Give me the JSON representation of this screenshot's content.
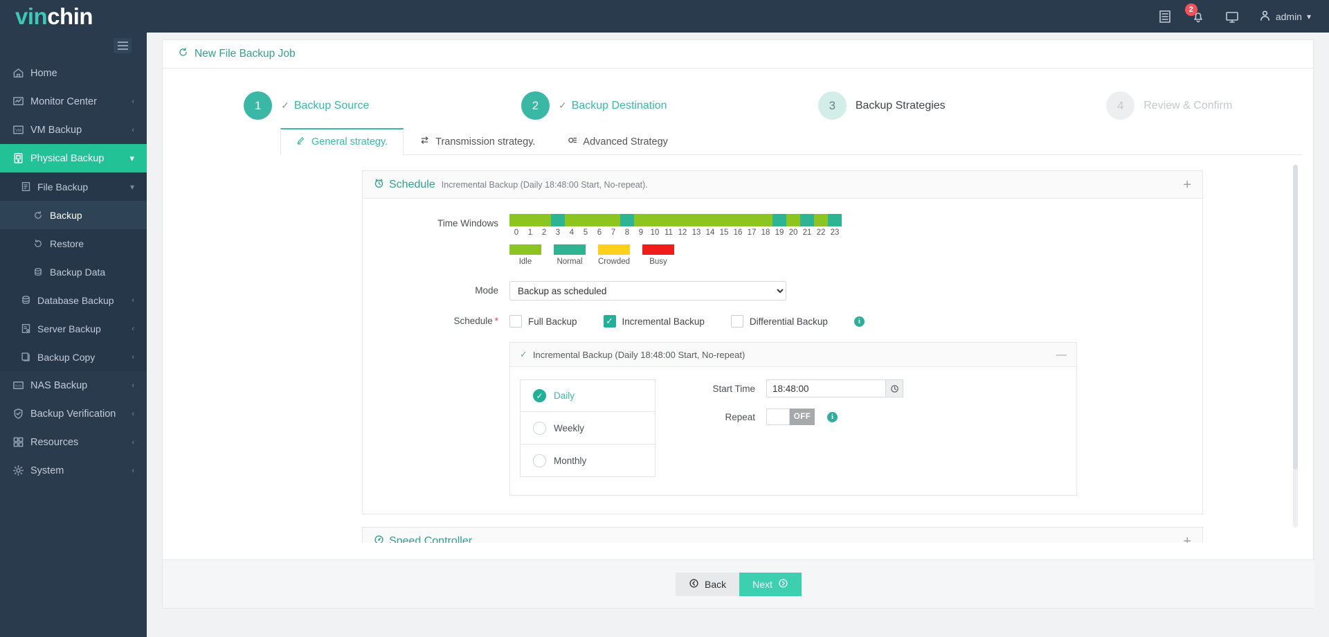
{
  "brand": {
    "part1": "vin",
    "part2": "chin"
  },
  "header": {
    "notifications_badge": "2",
    "user_label": "admin",
    "icons": [
      "log-icon",
      "bell-icon",
      "monitor-icon",
      "user-icon"
    ]
  },
  "sidebar": {
    "items": [
      {
        "label": "Home",
        "icon": "home-icon",
        "chevron": "",
        "level": 0
      },
      {
        "label": "Monitor Center",
        "icon": "monitor-chart-icon",
        "chevron": "‹",
        "level": 0
      },
      {
        "label": "VM Backup",
        "icon": "vm-icon",
        "chevron": "‹",
        "level": 0
      },
      {
        "label": "Physical Backup",
        "icon": "server-icon",
        "chevron": "⌄",
        "level": 0,
        "active": true
      },
      {
        "label": "File Backup",
        "icon": "file-icon",
        "chevron": "⌄",
        "level": 1
      },
      {
        "label": "Backup",
        "icon": "backup-refresh-icon",
        "level": 2,
        "current": true
      },
      {
        "label": "Restore",
        "icon": "restore-icon",
        "level": 2
      },
      {
        "label": "Backup Data",
        "icon": "database-icon",
        "level": 2
      },
      {
        "label": "Database Backup",
        "icon": "database-icon",
        "chevron": "‹",
        "level": 1
      },
      {
        "label": "Server Backup",
        "icon": "server-file-icon",
        "chevron": "‹",
        "level": 1
      },
      {
        "label": "Backup Copy",
        "icon": "copy-icon",
        "chevron": "‹",
        "level": 1
      },
      {
        "label": "NAS Backup",
        "icon": "nas-icon",
        "chevron": "‹",
        "level": 0
      },
      {
        "label": "Backup Verification",
        "icon": "shield-check-icon",
        "chevron": "‹",
        "level": 0
      },
      {
        "label": "Resources",
        "icon": "grid-icon",
        "chevron": "‹",
        "level": 0
      },
      {
        "label": "System",
        "icon": "gear-icon",
        "chevron": "‹",
        "level": 0
      }
    ]
  },
  "page": {
    "title": "New File Backup Job",
    "title_icon": "refresh-icon"
  },
  "steps": [
    {
      "num": "1",
      "label": "Backup Source",
      "state": "done"
    },
    {
      "num": "2",
      "label": "Backup Destination",
      "state": "done"
    },
    {
      "num": "3",
      "label": "Backup Strategies",
      "state": "current"
    },
    {
      "num": "4",
      "label": "Review & Confirm",
      "state": "todo"
    }
  ],
  "tabs": [
    {
      "label": "General strategy.",
      "icon": "pencil-icon",
      "active": true
    },
    {
      "label": "Transmission strategy.",
      "icon": "transfer-icon",
      "active": false
    },
    {
      "label": "Advanced Strategy",
      "icon": "gear-slider-icon",
      "active": false
    }
  ],
  "schedule_panel": {
    "title": "Schedule",
    "icon": "clock-icon",
    "summary": "Incremental Backup (Daily 18:48:00 Start, No-repeat).",
    "toggle": "+",
    "time_windows_label": "Time Windows",
    "mode_label": "Mode",
    "mode_value": "Backup as scheduled",
    "mode_options": [
      "Backup as scheduled"
    ],
    "schedule_label": "Schedule",
    "schedule_required": "*",
    "checkboxes": [
      {
        "label": "Full Backup",
        "checked": false
      },
      {
        "label": "Incremental Backup",
        "checked": true
      },
      {
        "label": "Differential Backup",
        "checked": false
      }
    ],
    "info_icon": "info-icon"
  },
  "chart_data": {
    "type": "heatmap",
    "title": "Time Windows",
    "xlabel": "",
    "ylabel": "",
    "categories": [
      "0",
      "1",
      "2",
      "3",
      "4",
      "5",
      "6",
      "7",
      "8",
      "9",
      "10",
      "11",
      "12",
      "13",
      "14",
      "15",
      "16",
      "17",
      "18",
      "19",
      "20",
      "21",
      "22",
      "23"
    ],
    "values": [
      "Idle",
      "Idle",
      "Idle",
      "Normal",
      "Idle",
      "Idle",
      "Idle",
      "Idle",
      "Normal",
      "Idle",
      "Idle",
      "Idle",
      "Idle",
      "Idle",
      "Idle",
      "Idle",
      "Idle",
      "Idle",
      "Idle",
      "Normal",
      "Idle",
      "Normal",
      "Idle",
      "Normal"
    ],
    "legend": [
      {
        "label": "Idle",
        "color": "#8cc422"
      },
      {
        "label": "Normal",
        "color": "#2eb393"
      },
      {
        "label": "Crowded",
        "color": "#fdd01c"
      },
      {
        "label": "Busy",
        "color": "#f01b1b"
      }
    ],
    "legend_position": "below"
  },
  "incremental_panel": {
    "title": "Incremental Backup (Daily 18:48:00 Start, No-repeat)",
    "check_icon": "check-icon",
    "toggle": "—",
    "frequencies": [
      {
        "label": "Daily",
        "selected": true
      },
      {
        "label": "Weekly",
        "selected": false
      },
      {
        "label": "Monthly",
        "selected": false
      }
    ],
    "start_time_label": "Start Time",
    "start_time_value": "18:48:00",
    "start_time_placeholder": "HH:mm:ss",
    "clock_icon": "clock-icon",
    "repeat_label": "Repeat",
    "repeat_state": "OFF",
    "info_icon": "info-icon"
  },
  "speed_panel": {
    "title": "Speed Controller",
    "icon": "gauge-icon",
    "toggle": "+"
  },
  "footer": {
    "back_label": "Back",
    "back_icon": "arrow-left-circle-icon",
    "next_label": "Next",
    "next_icon": "arrow-right-circle-icon"
  },
  "colors": {
    "accent": "#3ab8a5",
    "sidebar": "#2b3b4e",
    "active_nav": "#22c196",
    "next_button": "#3ccfb0",
    "badge": "#f0515a"
  }
}
